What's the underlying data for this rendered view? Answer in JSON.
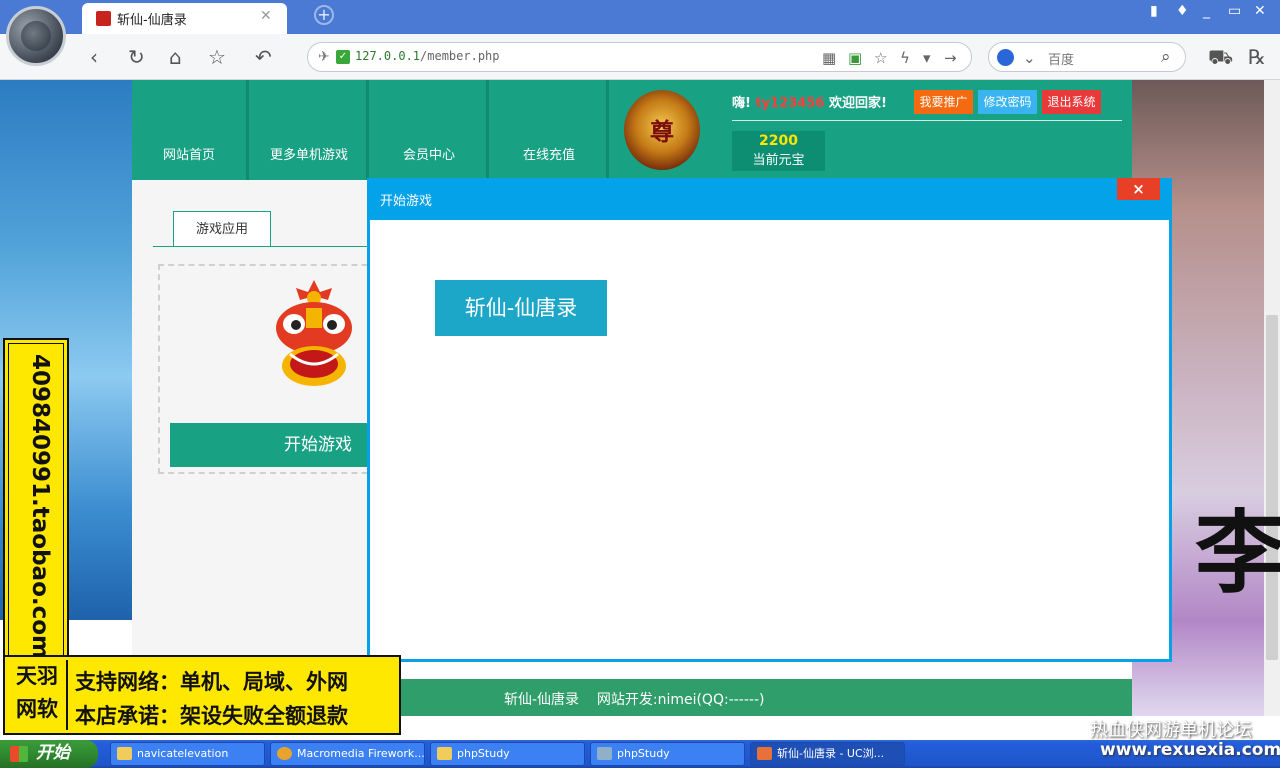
{
  "browser": {
    "tab_title": "斩仙-仙唐录",
    "url_host": "127.0.0.1",
    "url_path": "/member.php",
    "search_placeholder": "百度"
  },
  "site": {
    "nav": [
      "网站首页",
      "更多单机游戏",
      "会员中心",
      "在线充值"
    ],
    "medal_char": "尊",
    "greeting": "嗨!",
    "username": "ty123456",
    "welcome_suffix": "欢迎回家!",
    "buttons": {
      "promote": "我要推广",
      "change_password": "修改密码",
      "logout": "退出系统"
    },
    "coins_value": "2200",
    "coins_label": "当前元宝",
    "app_tab": "游戏应用",
    "start_game_button": "开始游戏",
    "footer_text": "斩仙-仙唐录    网站开发:nimei(QQ:------)"
  },
  "dialog": {
    "title": "开始游戏",
    "close_label": "×",
    "game_button": "斩仙-仙唐录"
  },
  "ad": {
    "vertical_text": "409840991.taobao.com",
    "logo_top": "天羽",
    "logo_bottom": "网软",
    "line1": "支持网络：单机、局域、外网",
    "line2": "本店承诺：架设失败全额退款"
  },
  "taskbar": {
    "start_label": "开始",
    "tasks": [
      "navicatelevation",
      "Macromedia Firework...",
      "phpStudy",
      "phpStudy",
      "斩仙-仙唐录 - UC浏..."
    ]
  },
  "watermark": {
    "line1": "热血侠网游单机论坛",
    "line2": "www.rexuexia.com"
  },
  "colors": {
    "site_green": "#19a184",
    "dialog_blue": "#04a2e8",
    "ad_yellow": "#ffe800",
    "close_red": "#e83f27"
  }
}
